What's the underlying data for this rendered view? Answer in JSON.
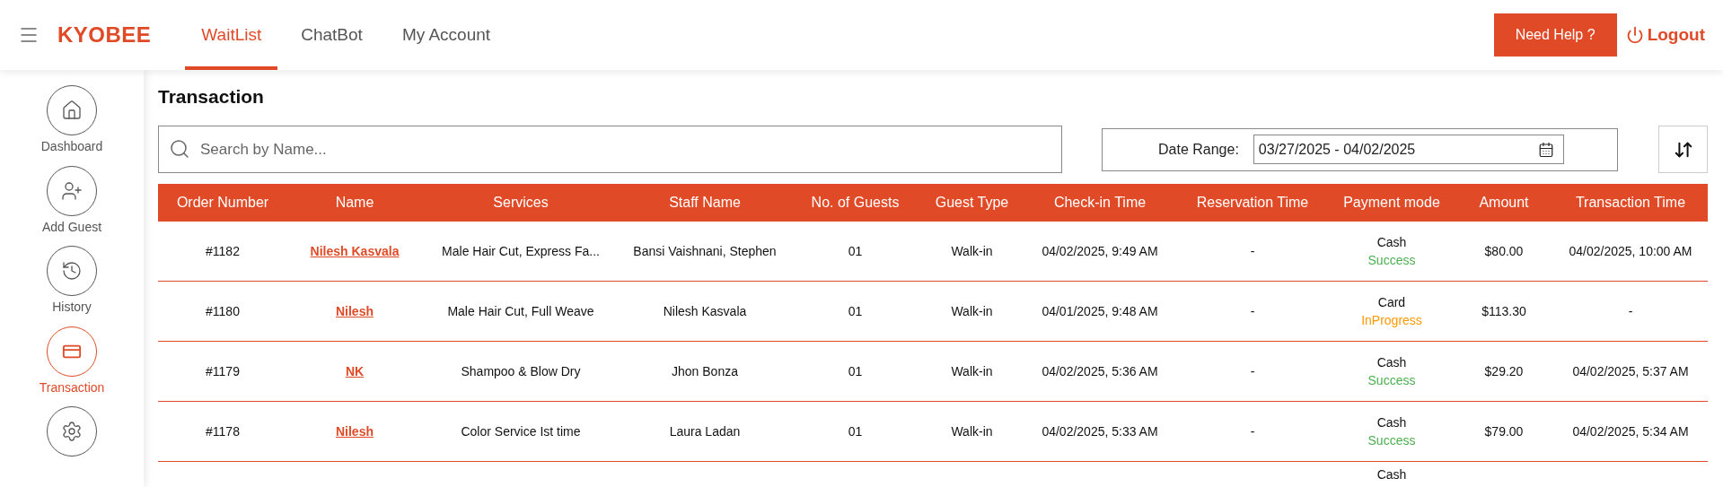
{
  "brand": "KYOBEE",
  "nav_tabs": [
    {
      "label": "WaitList",
      "selected": true
    },
    {
      "label": "ChatBot",
      "selected": false
    },
    {
      "label": "My Account",
      "selected": false
    }
  ],
  "help_button": "Need Help ?",
  "logout": "Logout",
  "sidebar": {
    "items": [
      {
        "label": "Dashboard",
        "kind": "home",
        "selected": false
      },
      {
        "label": "Add Guest",
        "kind": "add-user",
        "selected": false
      },
      {
        "label": "History",
        "kind": "history",
        "selected": false
      },
      {
        "label": "Transaction",
        "kind": "card",
        "selected": true
      },
      {
        "kind": "settings",
        "selected": false
      }
    ]
  },
  "page_title": "Transaction",
  "search": {
    "placeholder": "Search by Name..."
  },
  "date_range": {
    "label": "Date Range:",
    "value": "03/27/2025 - 04/02/2025"
  },
  "table": {
    "columns": [
      "Order Number",
      "Name",
      "Services",
      "Staff Name",
      "No. of Guests",
      "Guest Type",
      "Check-in Time",
      "Reservation Time",
      "Payment mode",
      "Amount",
      "Transaction Time"
    ],
    "rows": [
      {
        "order": "#1182",
        "name": "Nilesh Kasvala",
        "services": "Male Hair Cut, Express Fa...",
        "staff": "Bansi Vaishnani, Stephen",
        "guests": "01",
        "guest_type": "Walk-in",
        "checkin": "04/02/2025, 9:49 AM",
        "reservation": "-",
        "payment_mode": "Cash",
        "payment_status": {
          "text": "Success",
          "kind": "success"
        },
        "amount": "$80.00",
        "transaction_time": "04/02/2025, 10:00 AM"
      },
      {
        "order": "#1180",
        "name": "Nilesh",
        "services": "Male Hair Cut, Full Weave",
        "staff": "Nilesh Kasvala",
        "guests": "01",
        "guest_type": "Walk-in",
        "checkin": "04/01/2025, 9:48 AM",
        "reservation": "-",
        "payment_mode": "Card",
        "payment_status": {
          "text": "InProgress",
          "kind": "progress"
        },
        "amount": "$113.30",
        "transaction_time": "-"
      },
      {
        "order": "#1179",
        "name": "NK",
        "services": "Shampoo & Blow Dry",
        "staff": "Jhon Bonza",
        "guests": "01",
        "guest_type": "Walk-in",
        "checkin": "04/02/2025, 5:36 AM",
        "reservation": "-",
        "payment_mode": "Cash",
        "payment_status": {
          "text": "Success",
          "kind": "success"
        },
        "amount": "$29.20",
        "transaction_time": "04/02/2025, 5:37 AM"
      },
      {
        "order": "#1178",
        "name": "Nilesh",
        "services": "Color Service Ist time",
        "staff": "Laura Ladan",
        "guests": "01",
        "guest_type": "Walk-in",
        "checkin": "04/02/2025, 5:33 AM",
        "reservation": "-",
        "payment_mode": "Cash",
        "payment_status": {
          "text": "Success",
          "kind": "success"
        },
        "amount": "$79.00",
        "transaction_time": "04/02/2025, 5:34 AM"
      },
      {
        "payment_mode": "Cash"
      }
    ]
  }
}
